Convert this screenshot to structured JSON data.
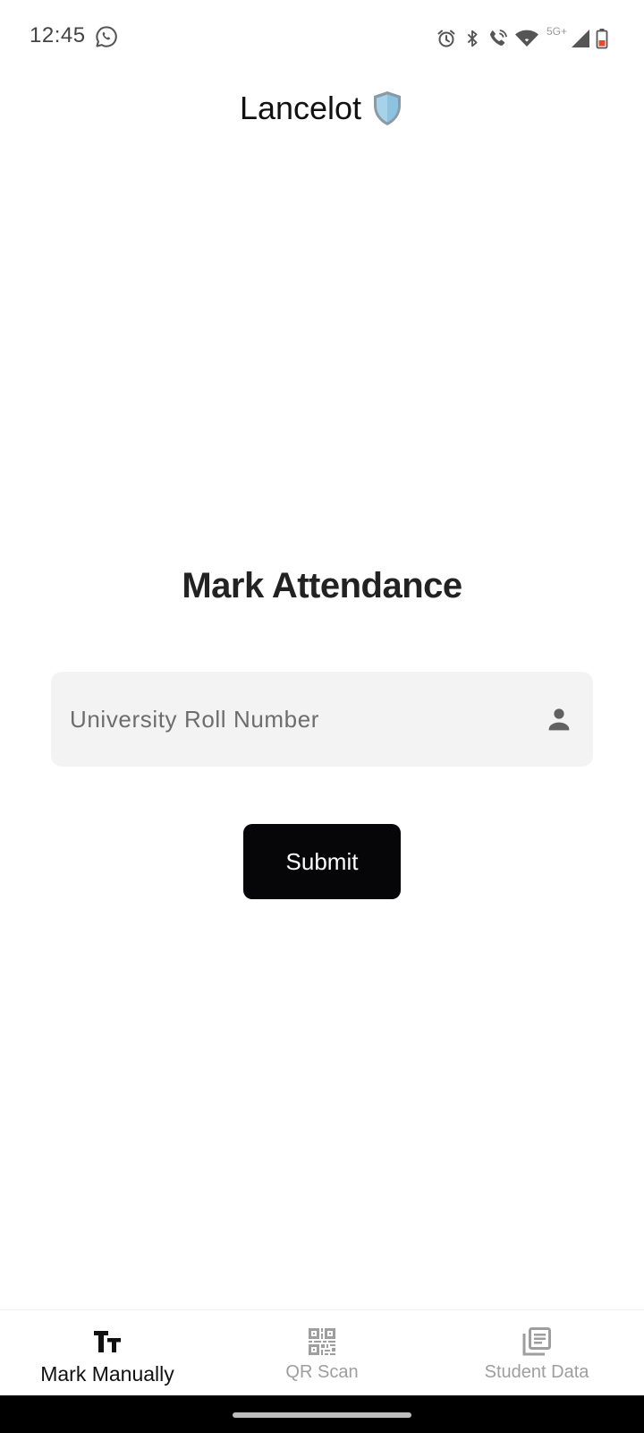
{
  "status_bar": {
    "time": "12:45",
    "network_type": "5G+",
    "icons": [
      "whatsapp-icon",
      "alarm-icon",
      "bluetooth-icon",
      "wifi-calling-icon",
      "wifi-icon",
      "cell-signal-icon",
      "battery-icon"
    ]
  },
  "app": {
    "title": "Lancelot",
    "title_icon": "shield-icon"
  },
  "main": {
    "heading": "Mark Attendance",
    "roll_field": {
      "placeholder": "University Roll Number",
      "value": "",
      "icon": "person-icon"
    },
    "submit_label": "Submit"
  },
  "bottom_nav": {
    "items": [
      {
        "label": "Mark Manually",
        "icon": "text-size-icon",
        "active": true
      },
      {
        "label": "QR Scan",
        "icon": "qr-code-icon",
        "active": false
      },
      {
        "label": "Student Data",
        "icon": "library-books-icon",
        "active": false
      }
    ]
  },
  "colors": {
    "primary_button": "#060508",
    "field_background": "#f3f3f3",
    "active_nav": "#111111",
    "inactive_nav": "#9e9e9e"
  }
}
